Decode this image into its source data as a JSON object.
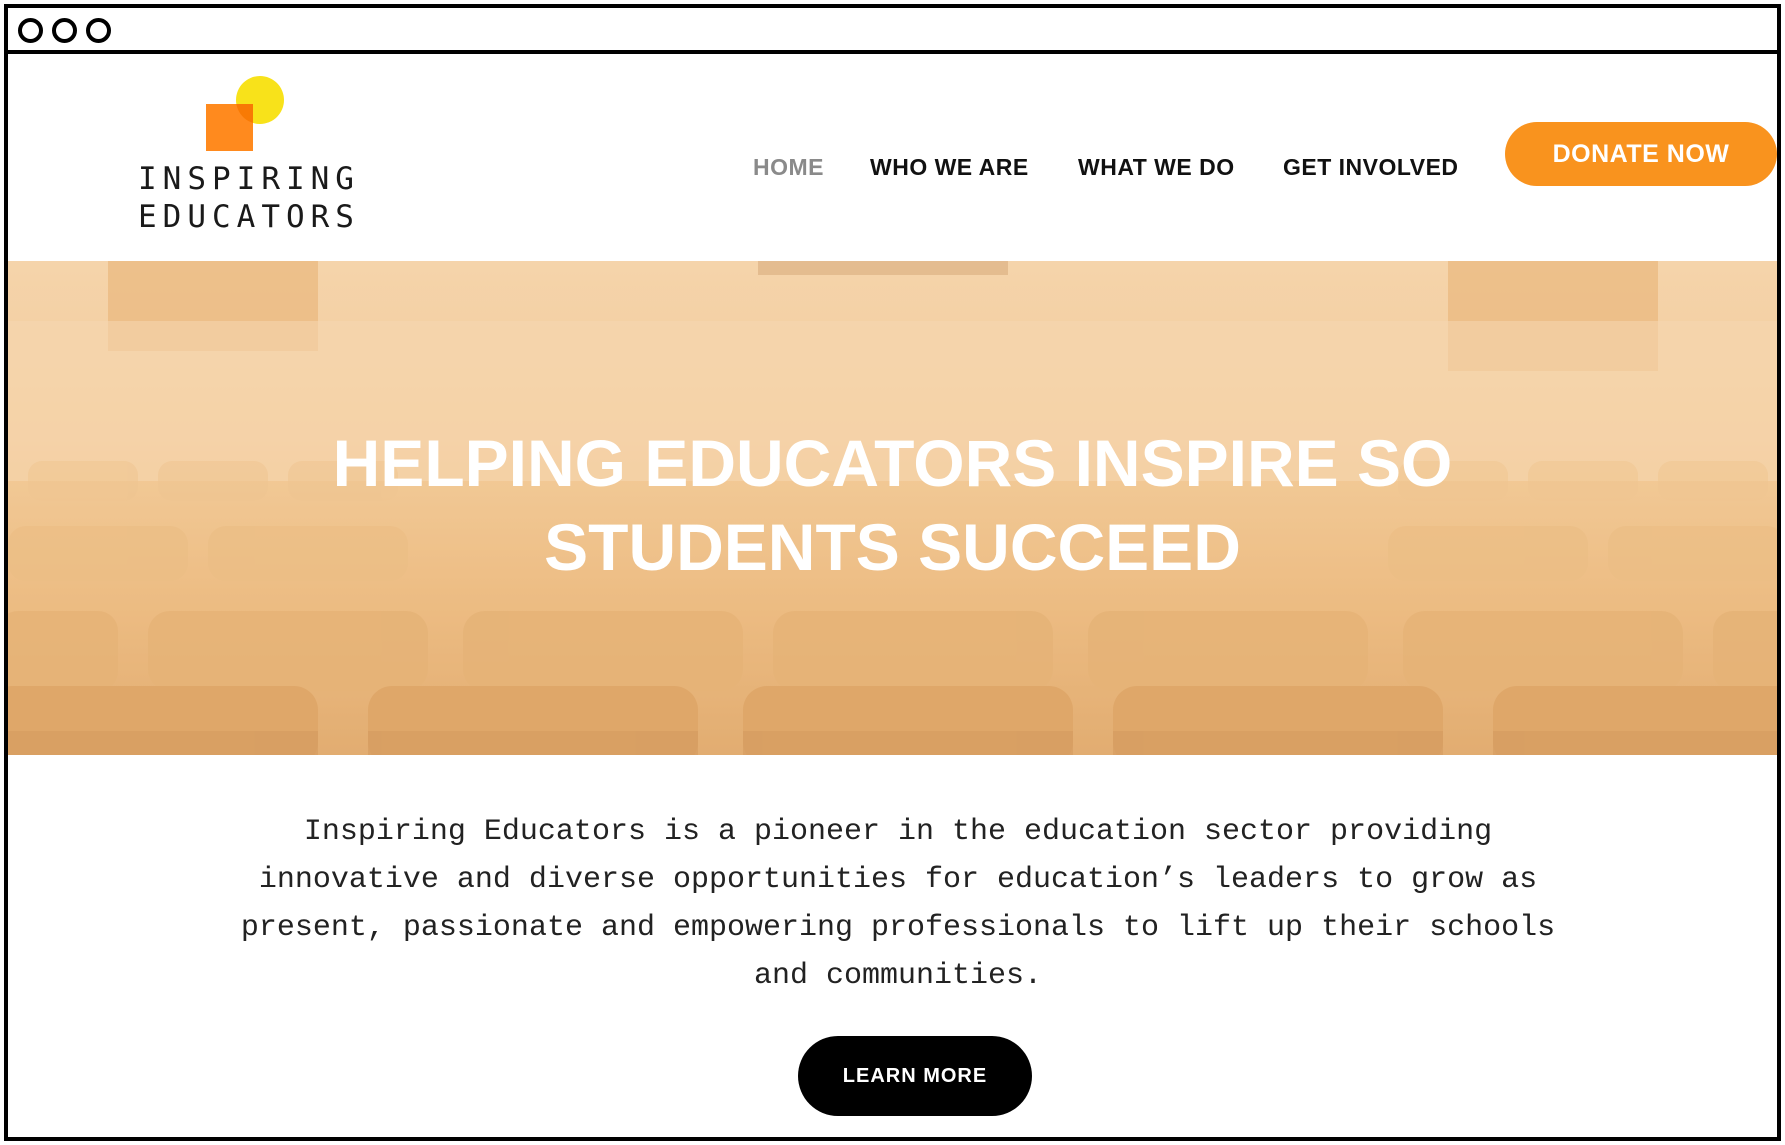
{
  "logo": {
    "line1": "INSPIRING",
    "line2": "EDUCATORS"
  },
  "nav": {
    "items": [
      {
        "label": "HOME",
        "active": true
      },
      {
        "label": "WHO WE ARE",
        "active": false
      },
      {
        "label": "WHAT WE DO",
        "active": false
      },
      {
        "label": "GET INVOLVED",
        "active": false
      }
    ],
    "donate_label": "DONATE NOW"
  },
  "hero": {
    "title": "HELPING EDUCATORS INSPIRE SO STUDENTS SUCCEED"
  },
  "about": {
    "text": "Inspiring Educators is a pioneer in the education sector providing innovative and diverse opportunities for education’s leaders to grow as present, passionate and empowering professionals to lift up their schools and communities."
  },
  "cta": {
    "learn_more_label": "LEARN MORE"
  },
  "colors": {
    "accent_orange": "#f9931e",
    "logo_square": "#ff8a1e",
    "logo_circle": "#f8e21a",
    "button_black": "#000000",
    "nav_active": "#8a8a8a"
  }
}
